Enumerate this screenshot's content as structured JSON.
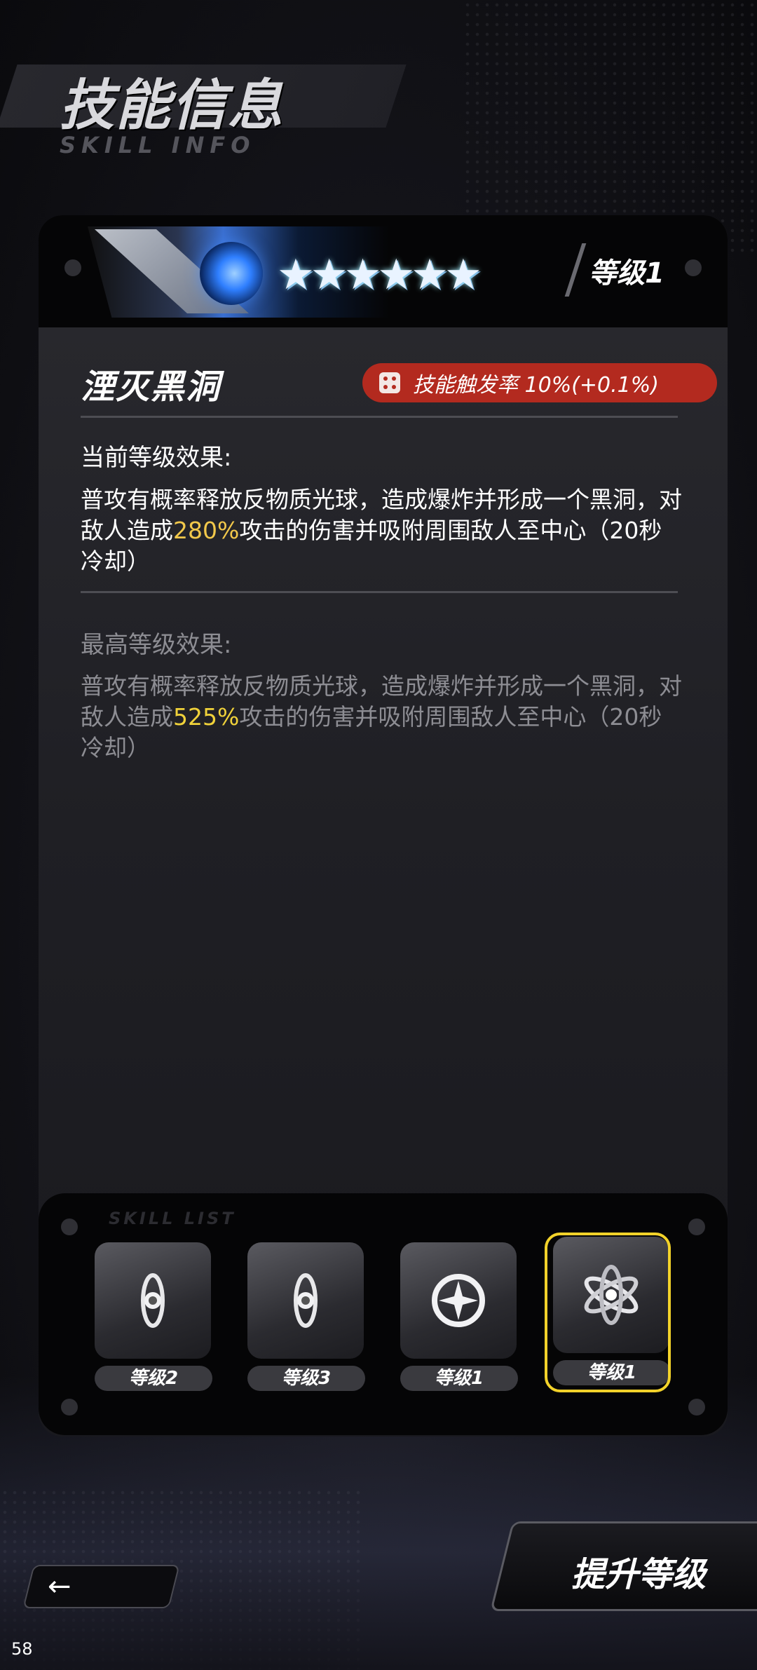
{
  "header": {
    "title": "技能信息",
    "subtitle": "SKILL INFO"
  },
  "card": {
    "stars": "★★★★★★",
    "level_label": "等级1",
    "skill_name": "湮灭黑洞",
    "trigger_rate": "技能触发率  10%(+0.1%)",
    "current": {
      "heading": "当前等级效果:",
      "text_before": "普攻有概率释放反物质光球，造成爆炸并形成一个黑洞，对敌人造成",
      "highlight": "280%",
      "text_after": "攻击的伤害并吸附周围敌人至中心（20秒冷却）"
    },
    "max": {
      "heading": "最高等级效果:",
      "text_before": "普攻有概率释放反物质光球，造成爆炸并形成一个黑洞，对敌人造成",
      "highlight": "525%",
      "text_after": "攻击的伤害并吸附周围敌人至中心（20秒冷却）"
    }
  },
  "skill_bar": {
    "label": "SKILL LIST",
    "slots": [
      {
        "icon": "spiral-orb-icon",
        "level": "等级2"
      },
      {
        "icon": "spiral-orb-icon",
        "level": "等级3"
      },
      {
        "icon": "star-ring-icon",
        "level": "等级1"
      },
      {
        "icon": "atom-icon",
        "level": "等级1",
        "selected": true
      }
    ]
  },
  "upgrade_button": "提升等级",
  "back_icon": "back-arrow-icon",
  "fps_counter": "58",
  "colors": {
    "highlight": "#f2c84b",
    "rate_bg": "#b32a1f",
    "selected_frame": "#f2d22a"
  }
}
